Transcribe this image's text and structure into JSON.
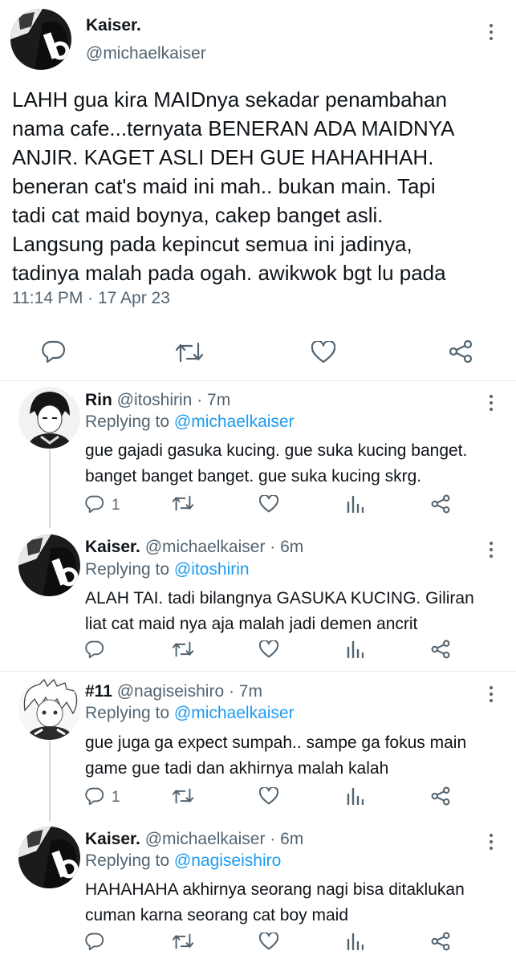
{
  "main": {
    "name": "Kaiser.",
    "handle": "@michaelkaiser",
    "text_lines": [
      "LAHH gua kira MAIDnya sekadar penambahan",
      "nama cafe...ternyata BENERAN ADA MAIDNYA",
      "ANJIR. KAGET ASLI DEH GUE HAHAHHAH.",
      "beneran cat's maid ini mah.. bukan main. Tapi",
      "tadi cat maid boynya, cakep banget asli.",
      "Langsung pada kepincut semua ini jadinya,",
      "tadinya malah pada ogah. awikwok bgt lu pada"
    ],
    "timestamp": "11:14 PM · 17 Apr 23"
  },
  "replies": [
    {
      "name": "Rin",
      "handle": "@itoshirin",
      "time": "· 7m",
      "replying_label": "Replying to",
      "replying_to": "@michaelkaiser",
      "text_lines": [
        "gue gajadi gasuka kucing. gue suka kucing banget.",
        "banget banget banget. gue suka kucing skrg."
      ],
      "reply_count": "1"
    },
    {
      "name": "Kaiser.",
      "handle": "@michaelkaiser",
      "time": "· 6m",
      "replying_label": "Replying to",
      "replying_to": "@itoshirin",
      "text_lines": [
        "ALAH TAI. tadi bilangnya GASUKA KUCING. Giliran",
        "liat cat maid nya aja malah jadi demen ancrit"
      ],
      "reply_count": ""
    },
    {
      "name": "#11",
      "handle": "@nagiseishiro",
      "time": "· 7m",
      "replying_label": "Replying to",
      "replying_to": "@michaelkaiser",
      "text_lines": [
        "gue juga ga expect sumpah.. sampe ga fokus main",
        "game gue tadi dan akhirnya malah kalah"
      ],
      "reply_count": "1"
    },
    {
      "name": "Kaiser.",
      "handle": "@michaelkaiser",
      "time": "· 6m",
      "replying_label": "Replying to",
      "replying_to": "@nagiseishiro",
      "text_lines": [
        "HAHAHAHA akhirnya seorang nagi bisa ditaklukan",
        "cuman karna seorang cat boy maid"
      ],
      "reply_count": ""
    }
  ],
  "icons": [
    "more-icon",
    "reply-icon",
    "retweet-icon",
    "like-icon",
    "share-icon",
    "analytics-icon"
  ],
  "colors": {
    "text": "#0f1419",
    "muted": "#536471",
    "link": "#1d9bf0",
    "divider": "#e6ecf0"
  }
}
